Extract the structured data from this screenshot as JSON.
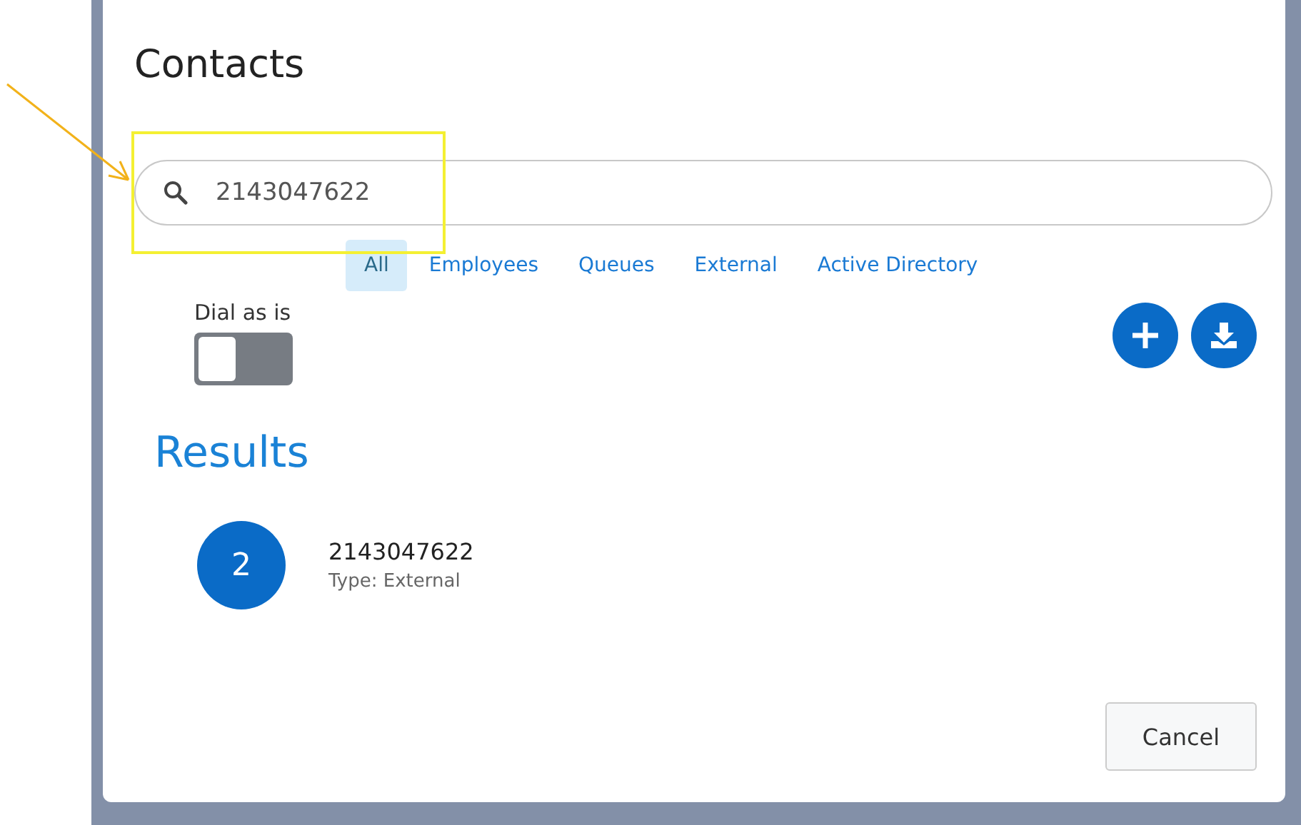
{
  "dialog": {
    "title": "Contacts",
    "search": {
      "value": "2143047622"
    },
    "tabs": [
      {
        "label": "All",
        "selected": true
      },
      {
        "label": "Employees",
        "selected": false
      },
      {
        "label": "Queues",
        "selected": false
      },
      {
        "label": "External",
        "selected": false
      },
      {
        "label": "Active Directory",
        "selected": false
      }
    ],
    "dial_as_is": {
      "label": "Dial as is",
      "on": false
    },
    "results_heading": "Results",
    "results": [
      {
        "avatar": "2",
        "name": "2143047622",
        "type": "Type: External"
      }
    ],
    "buttons": [
      "Cancel"
    ]
  }
}
